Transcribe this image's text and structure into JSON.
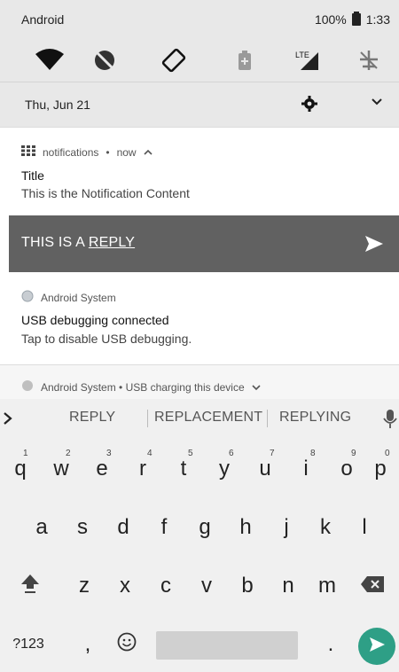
{
  "status_bar": {
    "carrier": "Android",
    "battery_text": "100%",
    "time": "1:33"
  },
  "quick_settings": {
    "icons": [
      "wifi-icon",
      "do-not-disturb-off-icon",
      "auto-rotate-icon",
      "battery-saver-icon",
      "lte-signal-icon",
      "airplane-mode-icon"
    ]
  },
  "date_row": {
    "date": "Thu, Jun 21"
  },
  "notification1": {
    "app": "notifications",
    "time": "now",
    "title": "Title",
    "content": "This is the Notification Content"
  },
  "reply_bar": {
    "prefix": "THIS IS A",
    "typed": "REPLY"
  },
  "notification2": {
    "app": "Android System",
    "title": "USB debugging connected",
    "content": "Tap to disable USB debugging."
  },
  "notification3": {
    "header": "Android System • USB charging this device"
  },
  "keyboard": {
    "suggestions": [
      "REPLY",
      "REPLACEMENT",
      "REPLYING"
    ],
    "row1": [
      "q",
      "w",
      "e",
      "r",
      "t",
      "y",
      "u",
      "i",
      "o",
      "p"
    ],
    "row1_hints": [
      "1",
      "2",
      "3",
      "4",
      "5",
      "6",
      "7",
      "8",
      "9",
      "0"
    ],
    "row2": [
      "a",
      "s",
      "d",
      "f",
      "g",
      "h",
      "j",
      "k",
      "l"
    ],
    "row3": [
      "z",
      "x",
      "c",
      "v",
      "b",
      "n",
      "m"
    ],
    "symbols": "?123",
    "comma": ",",
    "period": "."
  },
  "colors": {
    "reply_bar_bg": "#616161",
    "enter_key": "#2e9f86",
    "shade_bg": "#e8e8e8"
  }
}
